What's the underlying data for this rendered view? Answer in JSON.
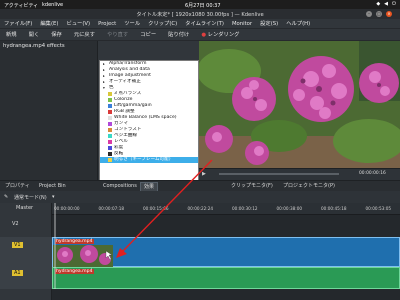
{
  "topbar": {
    "activities": "アクティビティ",
    "app_name": "kdenlive",
    "clock": "6月27日 00:37"
  },
  "window": {
    "title": "タイトル未定* [ 1920x1080 30.00fps ] — Kdenlive"
  },
  "menubar": {
    "items": [
      "ファイル(F)",
      "編集(E)",
      "ビュー(V)",
      "Project",
      "ツール",
      "クリップ(C)",
      "タイムライン(T)",
      "Monitor",
      "設定(S)",
      "ヘルプ(H)"
    ]
  },
  "toolbar": {
    "items": [
      "新規",
      "開く",
      "保存",
      "元に戻す",
      "やり直す",
      "コピー",
      "貼り付け"
    ],
    "render_label": "レンダリング"
  },
  "left_panel": {
    "header": "hydrangea.mp4 effects"
  },
  "effects_list": {
    "items": [
      {
        "label": "Alpha/Transform",
        "indent": 0,
        "tri": "▸",
        "color": "",
        "selected": false
      },
      {
        "label": "Analysis and data",
        "indent": 0,
        "tri": "▸",
        "color": "",
        "selected": false
      },
      {
        "label": "Image adjustment",
        "indent": 0,
        "tri": "▸",
        "color": "",
        "selected": false
      },
      {
        "label": "オーディオ補正",
        "indent": 0,
        "tri": "▸",
        "color": "",
        "selected": false
      },
      {
        "label": "色",
        "indent": 0,
        "tri": "▾",
        "color": "",
        "selected": false
      },
      {
        "label": "3 点バランス",
        "indent": 1,
        "tri": "",
        "color": "#d9c73a",
        "selected": false
      },
      {
        "label": "Colorize",
        "indent": 1,
        "tri": "",
        "color": "#7bc24a",
        "selected": false
      },
      {
        "label": "Lift/gamma/gain",
        "indent": 1,
        "tri": "",
        "color": "#3a7fd9",
        "selected": false
      },
      {
        "label": "RGB 調整",
        "indent": 1,
        "tri": "",
        "color": "#d93a3a",
        "selected": false
      },
      {
        "label": "White Balance (LMS space)",
        "indent": 1,
        "tri": "",
        "color": "#e0e0e0",
        "selected": false
      },
      {
        "label": "ガンマ",
        "indent": 1,
        "tri": "",
        "color": "#b04ad9",
        "selected": false
      },
      {
        "label": "コントラスト",
        "indent": 1,
        "tri": "",
        "color": "#d98a3a",
        "selected": false
      },
      {
        "label": "ベジエ曲線",
        "indent": 1,
        "tri": "",
        "color": "#3ad9c7",
        "selected": false
      },
      {
        "label": "レベル",
        "indent": 1,
        "tri": "",
        "color": "#d93aa5",
        "selected": false
      },
      {
        "label": "彩度",
        "indent": 1,
        "tri": "",
        "color": "#4a4ad9",
        "selected": false
      },
      {
        "label": "反転",
        "indent": 1,
        "tri": "",
        "color": "#2a2a2a",
        "selected": false
      },
      {
        "label": "明るさ（キーフレーム可能）",
        "indent": 1,
        "tri": "",
        "color": "#f0d040",
        "selected": true
      }
    ]
  },
  "monitor": {
    "timecode": "00:00:00:16"
  },
  "tabs": {
    "properties": "プロパティ",
    "project_bin": "Project Bin",
    "compositions": "Compositions",
    "effects": "効果",
    "clip_monitor": "クリップモニタ(F)",
    "project_monitor": "プロジェクトモニタ(P)"
  },
  "timeline": {
    "mode_label": "通常モード(N)",
    "ruler_ticks": [
      "00:00:00:00",
      "00:00:07:18",
      "00:00:15:06",
      "00:00:22:24",
      "00:00:30:12",
      "00:00:38:00",
      "00:00:45:18",
      "00:00:53:05"
    ],
    "master_label": "Master",
    "track_v2": "V2",
    "track_v1": "V1",
    "track_a1": "A1",
    "clip_name": "hydrangea.mp4"
  }
}
